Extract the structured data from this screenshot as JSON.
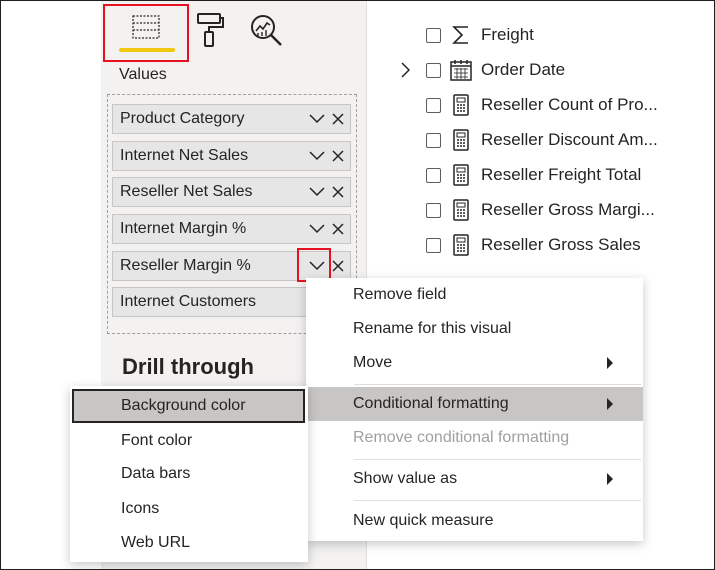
{
  "visualizations": {
    "tools": [
      {
        "name": "fields",
        "icon": "table-fields-icon",
        "selected": true
      },
      {
        "name": "format",
        "icon": "paint-roller-icon"
      },
      {
        "name": "analytics",
        "icon": "analytics-magnifier-icon"
      }
    ],
    "values_label": "Values",
    "value_fields": [
      {
        "label": "Product Category"
      },
      {
        "label": "Internet Net Sales"
      },
      {
        "label": "Reseller Net Sales"
      },
      {
        "label": "Internet Margin %"
      },
      {
        "label": "Reseller Margin %"
      },
      {
        "label": "Internet Customers"
      }
    ],
    "drill_through_title": "Drill through"
  },
  "fields_list": [
    {
      "label": "Freight",
      "icon": "sigma-icon",
      "expandable": false
    },
    {
      "label": "Order Date",
      "icon": "calendar-icon",
      "expandable": true
    },
    {
      "label": "Reseller Count of Pro...",
      "icon": "calculator-icon",
      "expandable": false
    },
    {
      "label": "Reseller Discount Am...",
      "icon": "calculator-icon",
      "expandable": false
    },
    {
      "label": "Reseller Freight Total",
      "icon": "calculator-icon",
      "expandable": false
    },
    {
      "label": "Reseller Gross Margi...",
      "icon": "calculator-icon",
      "expandable": false
    },
    {
      "label": "Reseller Gross Sales",
      "icon": "calculator-icon",
      "expandable": false
    }
  ],
  "context_menu": {
    "items": [
      {
        "label": "Remove field"
      },
      {
        "label": "Rename for this visual"
      },
      {
        "label": "Move",
        "submenu": true
      },
      {
        "label": "Conditional formatting",
        "submenu": true,
        "highlighted": true
      },
      {
        "label": "Remove conditional formatting",
        "disabled": true
      },
      {
        "label": "Show value as",
        "submenu": true
      },
      {
        "label": "New quick measure"
      }
    ]
  },
  "submenu": {
    "items": [
      {
        "label": "Background color",
        "highlighted": true
      },
      {
        "label": "Font color"
      },
      {
        "label": "Data bars"
      },
      {
        "label": "Icons"
      },
      {
        "label": "Web URL"
      }
    ]
  },
  "colors": {
    "highlight_outline": "#e81123",
    "selected_tab_underline": "#f2c811",
    "pane_background": "#f3f2f1",
    "menu_hover": "#c8c6c4"
  }
}
